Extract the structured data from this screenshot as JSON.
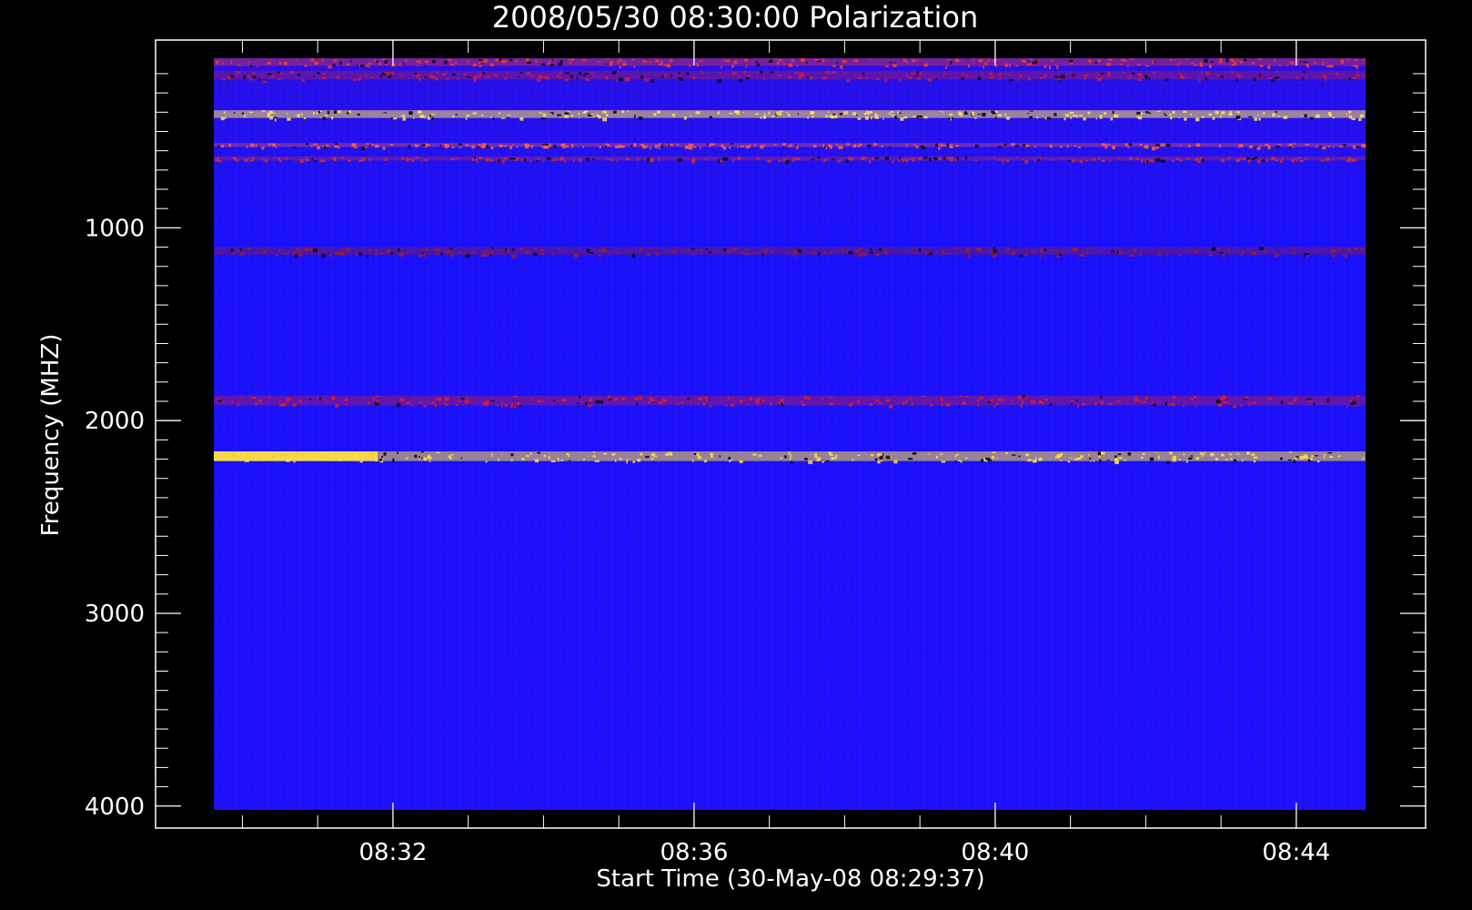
{
  "chart_data": {
    "type": "heatmap",
    "title": "2008/05/30 08:30:00 Polarization",
    "xlabel": "Start Time (30-May-08 08:29:37)",
    "ylabel": "Frequency (MHZ)",
    "x_tick_labels": [
      "08:32",
      "08:36",
      "08:40",
      "08:44"
    ],
    "x_tick_minutes": [
      32,
      36,
      40,
      44
    ],
    "x_range_minutes": [
      29.62,
      44.92
    ],
    "y_tick_labels": [
      "1000",
      "2000",
      "3000",
      "4000"
    ],
    "y_tick_values": [
      1000,
      2000,
      3000,
      4000
    ],
    "ylim": [
      120,
      4020
    ],
    "y_axis_inverted": true,
    "colormap": [
      "#000000",
      "#0000ff",
      "#b00000",
      "#ff3000",
      "#ffd000",
      "#ffff80"
    ],
    "background_color": "#1e10ff",
    "bands": [
      {
        "freq_range": [
          120,
          160
        ],
        "intensity": "high",
        "color": "#ff4020"
      },
      {
        "freq_range": [
          185,
          230
        ],
        "intensity": "medium",
        "color": "#c02040"
      },
      {
        "freq_range": [
          390,
          430
        ],
        "intensity": "very high",
        "color": "#ffe060"
      },
      {
        "freq_range": [
          560,
          580
        ],
        "intensity": "high",
        "color": "#ff6040"
      },
      {
        "freq_range": [
          630,
          650
        ],
        "intensity": "medium",
        "color": "#d03030"
      },
      {
        "freq_range": [
          1100,
          1140
        ],
        "intensity": "medium",
        "color": "#a02020"
      },
      {
        "freq_range": [
          1870,
          1920
        ],
        "intensity": "high",
        "color": "#e02020"
      },
      {
        "freq_range": [
          2160,
          2210
        ],
        "intensity": "very high",
        "color": "#ffe040"
      }
    ]
  }
}
